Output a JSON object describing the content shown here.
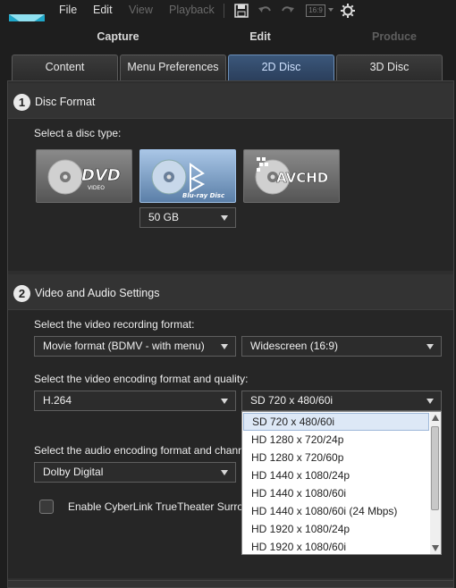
{
  "menu": {
    "file": "File",
    "edit": "Edit",
    "view": "View",
    "playback": "Playback",
    "resolution_icon": "16:9"
  },
  "modes": {
    "capture": "Capture",
    "edit": "Edit",
    "produce": "Produce"
  },
  "tabs": [
    "Content",
    "Menu Preferences",
    "2D Disc",
    "3D Disc"
  ],
  "active_tab": "2D Disc",
  "disc_format": {
    "number": "1",
    "title": "Disc Format",
    "select_label": "Select a disc type:",
    "discs": [
      {
        "name": "DVD",
        "sub": "VIDEO",
        "selected": false
      },
      {
        "name": "Blu-ray Disc",
        "sub": "",
        "selected": true
      },
      {
        "name": "AVCHD",
        "sub": "",
        "selected": false
      }
    ],
    "capacity": "50 GB"
  },
  "video_audio": {
    "number": "2",
    "title": "Video and Audio Settings",
    "recording_label": "Select the video recording format:",
    "recording_format": "Movie format (BDMV - with menu)",
    "aspect": "Widescreen (16:9)",
    "encoding_label": "Select the video encoding format and quality:",
    "codec": "H.264",
    "quality": "SD 720 x 480/60i",
    "quality_options": [
      "SD 720 x 480/60i",
      "HD 1280 x 720/24p",
      "HD 1280 x 720/60p",
      "HD 1440 x 1080/24p",
      "HD 1440 x 1080/60i",
      "HD 1440 x 1080/60i (24 Mbps)",
      "HD 1920 x 1080/24p",
      "HD 1920 x 1080/60i"
    ],
    "audio_label": "Select the audio encoding format and chann",
    "audio_format": "Dolby Digital",
    "trutheater_label": "Enable CyberLink TrueTheater Surrou"
  },
  "colors": {
    "accent": "#3b577a",
    "selected_option": "#dde8f6",
    "panel": "#2e2e2e"
  }
}
